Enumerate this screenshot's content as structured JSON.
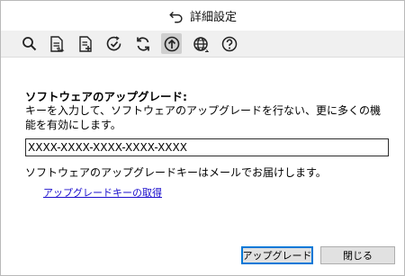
{
  "window": {
    "title": "詳細設定"
  },
  "toolbar": {
    "icons": [
      "search-icon",
      "document-list-icon",
      "document-add-icon",
      "check-circle-icon",
      "refresh-icon",
      "upload-cloud-icon",
      "globe-icon",
      "help-icon"
    ],
    "active": "upload-cloud-icon"
  },
  "main": {
    "section_title": "ソフトウェアのアップグレード:",
    "description": "キーを入力して、ソフトウェアのアップグレードを行ない、更に多くの機能を有効にします。",
    "key_input": {
      "value": "XXXX-XXXX-XXXX-XXXX-XXXX"
    },
    "note": "ソフトウェアのアップグレードキーはメールでお届けします。",
    "link": "アップグレードキーの取得"
  },
  "buttons": {
    "upgrade": "アップグレード",
    "close": "閉じる"
  },
  "colors": {
    "link": "#1a0dcc",
    "toolbar_bg": "#f0f0f0",
    "primary_border": "#0078d7"
  }
}
